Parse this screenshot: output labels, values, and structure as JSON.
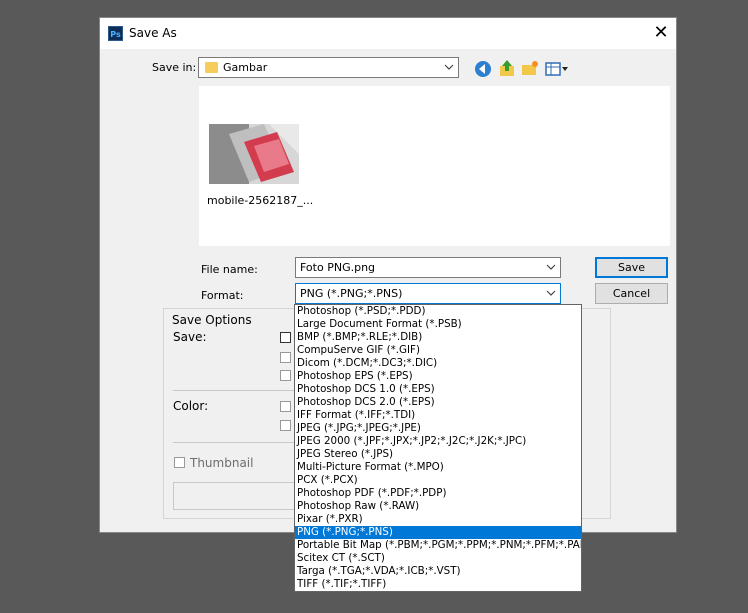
{
  "window": {
    "title": "Save As",
    "app_icon": "Ps",
    "close_symbol": "✕"
  },
  "save_in": {
    "label": "Save in:",
    "value": "Gambar"
  },
  "toolbar": {
    "icons": [
      "back-icon",
      "up-folder-icon",
      "new-folder-icon",
      "view-menu-icon"
    ]
  },
  "file": {
    "thumbnail_name": "mobile-2562187_..."
  },
  "file_name": {
    "label": "File name:",
    "value": "Foto PNG.png"
  },
  "format": {
    "label": "Format:",
    "value": "PNG (*.PNG;*.PNS)",
    "options": [
      "Photoshop (*.PSD;*.PDD)",
      "Large Document Format (*.PSB)",
      "BMP (*.BMP;*.RLE;*.DIB)",
      "CompuServe GIF (*.GIF)",
      "Dicom (*.DCM;*.DC3;*.DIC)",
      "Photoshop EPS (*.EPS)",
      "Photoshop DCS 1.0 (*.EPS)",
      "Photoshop DCS 2.0 (*.EPS)",
      "IFF Format (*.IFF;*.TDI)",
      "JPEG (*.JPG;*.JPEG;*.JPE)",
      "JPEG 2000 (*.JPF;*.JPX;*.JP2;*.J2C;*.J2K;*.JPC)",
      "JPEG Stereo (*.JPS)",
      "Multi-Picture Format (*.MPO)",
      "PCX (*.PCX)",
      "Photoshop PDF (*.PDF;*.PDP)",
      "Photoshop Raw (*.RAW)",
      "Pixar (*.PXR)",
      "PNG (*.PNG;*.PNS)",
      "Portable Bit Map (*.PBM;*.PGM;*.PPM;*.PNM;*.PFM;*.PAM)",
      "Scitex CT (*.SCT)",
      "Targa (*.TGA;*.VDA;*.ICB;*.VST)",
      "TIFF (*.TIF;*.TIFF)"
    ],
    "selected_index": 17
  },
  "buttons": {
    "save": "Save",
    "cancel": "Cancel"
  },
  "save_options": {
    "legend": "Save Options",
    "save_label": "Save:",
    "color_label": "Color:",
    "thumbnail_label": "Thumbnail"
  },
  "colors": {
    "accent": "#0078d7",
    "background": "#595959",
    "dialog": "#f0f0f0"
  }
}
